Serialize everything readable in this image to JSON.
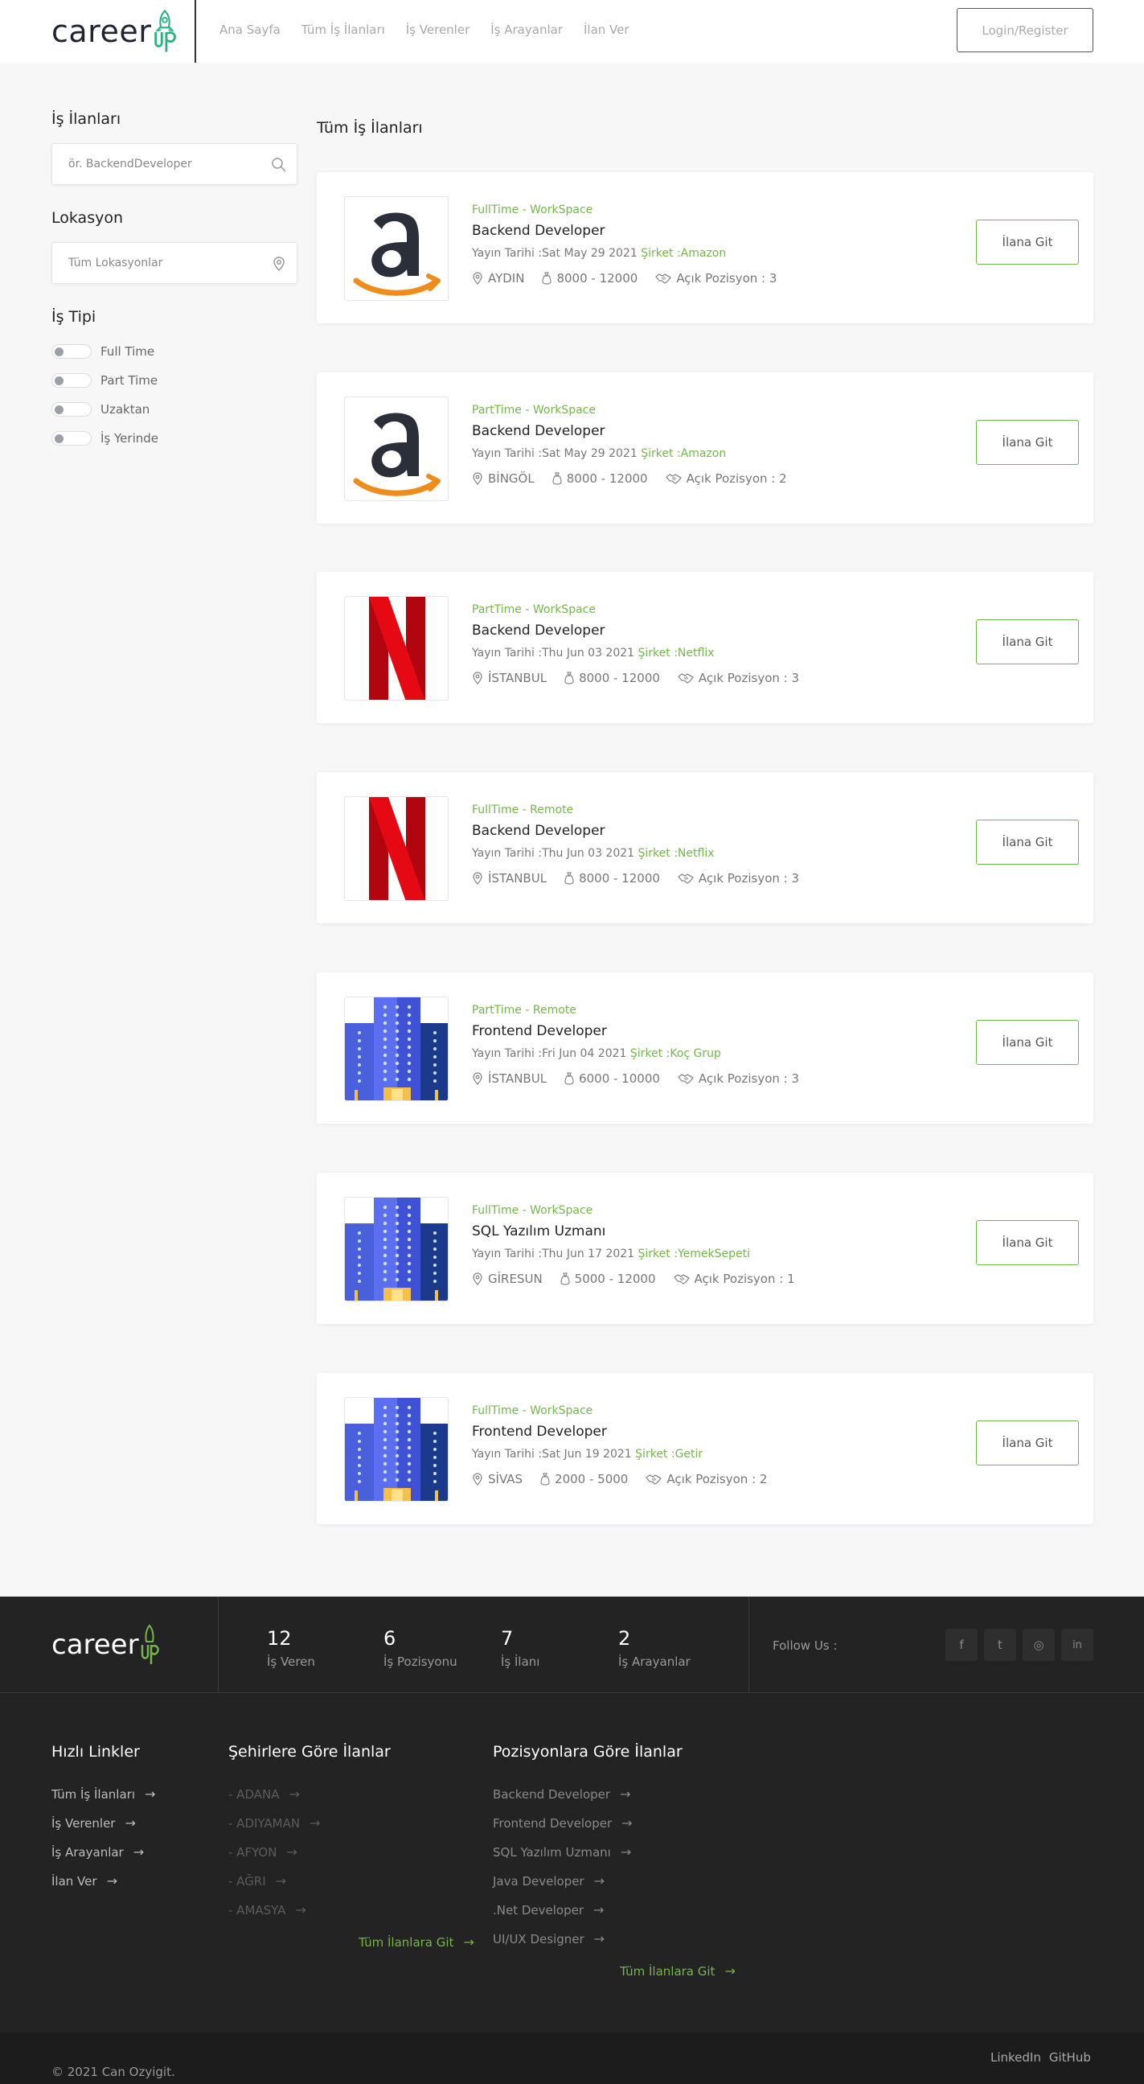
{
  "header": {
    "logo_text": "career",
    "nav": [
      "Ana Sayfa",
      "Tüm İş İlanları",
      "İş Verenler",
      "İş Arayanlar",
      "İlan Ver"
    ],
    "login_label": "Login/Register"
  },
  "sidebar": {
    "jobs_title": "İş İlanları",
    "search_placeholder": "ör. BackendDeveloper",
    "location_title": "Lokasyon",
    "location_placeholder": "Tüm Lokasyonlar",
    "type_title": "İş Tipi",
    "types": [
      "Full Time",
      "Part Time",
      "Uzaktan",
      "İş Yerinde"
    ]
  },
  "main": {
    "title": "Tüm İş İlanları",
    "jobs": [
      {
        "type": "FullTime - WorkSpace",
        "title": "Backend Developer",
        "date": "Yayın Tarihi :Sat May 29 2021",
        "company": "Şirket :Amazon",
        "city": "AYDIN",
        "salary": "8000 - 12000",
        "positions": "Açık Pozisyon : 3",
        "logo": "amazon-logo",
        "button": "İlana Git"
      },
      {
        "type": "PartTime - WorkSpace",
        "title": "Backend Developer",
        "date": "Yayın Tarihi :Sat May 29 2021",
        "company": "Şirket :Amazon",
        "city": "BİNGÖL",
        "salary": "8000 - 12000",
        "positions": "Açık Pozisyon : 2",
        "logo": "amazon-logo",
        "button": "İlana Git"
      },
      {
        "type": "PartTime - WorkSpace",
        "title": "Backend Developer",
        "date": "Yayın Tarihi :Thu Jun 03 2021",
        "company": "Şirket :Netflix",
        "city": "İSTANBUL",
        "salary": "8000 - 12000",
        "positions": "Açık Pozisyon : 3",
        "logo": "netflix-logo",
        "button": "İlana Git"
      },
      {
        "type": "FullTime - Remote",
        "title": "Backend Developer",
        "date": "Yayın Tarihi :Thu Jun 03 2021",
        "company": "Şirket :Netflix",
        "city": "İSTANBUL",
        "salary": "8000 - 12000",
        "positions": "Açık Pozisyon : 3",
        "logo": "netflix-logo",
        "button": "İlana Git"
      },
      {
        "type": "PartTime - Remote",
        "title": "Frontend Developer",
        "date": "Yayın Tarihi :Fri Jun 04 2021",
        "company": "Şirket :Koç Grup",
        "city": "İSTANBUL",
        "salary": "6000 - 10000",
        "positions": "Açık Pozisyon : 3",
        "logo": "building-logo",
        "button": "İlana Git"
      },
      {
        "type": "FullTime - WorkSpace",
        "title": "SQL Yazılım Uzmanı",
        "date": "Yayın Tarihi :Thu Jun 17 2021",
        "company": "Şirket :YemekSepeti",
        "city": "GİRESUN",
        "salary": "5000 - 12000",
        "positions": "Açık Pozisyon : 1",
        "logo": "building-logo",
        "button": "İlana Git"
      },
      {
        "type": "FullTime - WorkSpace",
        "title": "Frontend Developer",
        "date": "Yayın Tarihi :Sat Jun 19 2021",
        "company": "Şirket :Getir",
        "city": "SİVAS",
        "salary": "2000 - 5000",
        "positions": "Açık Pozisyon : 2",
        "logo": "building-logo",
        "button": "İlana Git"
      }
    ]
  },
  "footer": {
    "logo_text": "career",
    "stats": [
      {
        "num": "12",
        "label": "İş Veren"
      },
      {
        "num": "6",
        "label": "İş Pozisyonu"
      },
      {
        "num": "7",
        "label": "İş İlanı"
      },
      {
        "num": "2",
        "label": "İş Arayanlar"
      }
    ],
    "follow": "Follow Us :",
    "social": [
      "f",
      "t",
      "◎",
      "in"
    ],
    "quick_title": "Hızlı Linkler",
    "quick_links": [
      "Tüm İş İlanları",
      "İş Verenler",
      "İş Arayanlar",
      "İlan Ver"
    ],
    "city_title": "Şehirlere Göre İlanlar",
    "city_links": [
      "- ADANA",
      "- ADIYAMAN",
      "- AFYON",
      "- AĞRI",
      "- AMASYA"
    ],
    "city_all": "Tüm İlanlara Git",
    "pos_title": "Pozisyonlara Göre İlanlar",
    "pos_links": [
      "Backend Developer",
      "Frontend Developer",
      "SQL Yazılım Uzmanı",
      "Java Developer",
      ".Net Developer",
      "UI/UX Designer"
    ],
    "pos_all": "Tüm İlanlara Git",
    "copyright": "© 2021 Can Ozyigit.",
    "bottom_links": [
      "LinkedIn",
      "GitHub"
    ],
    "accent": "#74b64a"
  }
}
